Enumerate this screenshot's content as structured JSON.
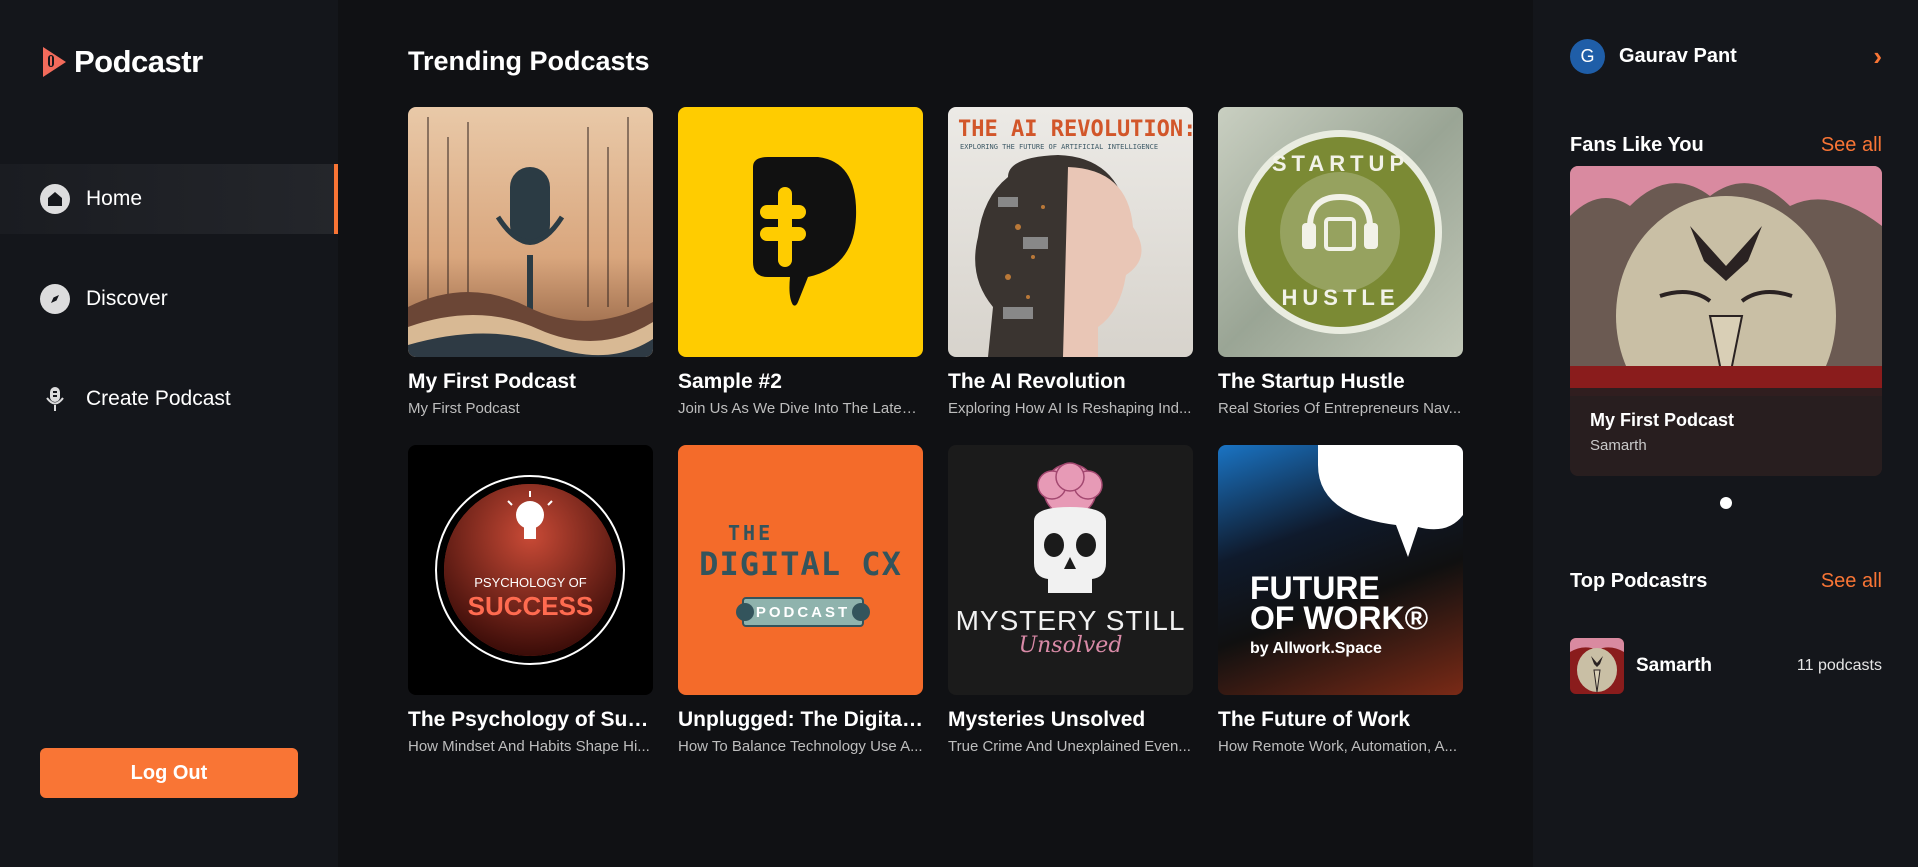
{
  "app": {
    "name": "Podcastr",
    "accent": "#f97535"
  },
  "nav": {
    "items": [
      {
        "label": "Home",
        "icon": "home-icon"
      },
      {
        "label": "Discover",
        "icon": "compass-icon"
      },
      {
        "label": "Create Podcast",
        "icon": "microphone-icon"
      }
    ],
    "logout_label": "Log Out"
  },
  "main": {
    "title": "Trending Podcasts",
    "podcasts": [
      {
        "title": "My First Podcast",
        "description": "My First Podcast"
      },
      {
        "title": "Sample #2",
        "description": "Join Us As We Dive Into The Latest..."
      },
      {
        "title": "The AI Revolution",
        "description": "Exploring How AI Is Reshaping Ind...",
        "cover_text": "THE AI REVOLUTION:",
        "cover_subtext": "EXPLORING THE FUTURE OF ARTIFICIAL INTELLIGENCE"
      },
      {
        "title": "The Startup Hustle",
        "description": "Real Stories Of Entrepreneurs Nav...",
        "cover_text": "STARTUP",
        "cover_subtext": "HUSTLE"
      },
      {
        "title": "The Psychology of Succ...",
        "description": "How Mindset And Habits Shape Hi...",
        "cover_text": "PSYCHOLOGY OF",
        "cover_subtext": "SUCCESS"
      },
      {
        "title": "Unplugged: The Digital ...",
        "description": "How To Balance Technology Use A...",
        "cover_text": "THE",
        "cover_subtext": "DIGITAL CX",
        "cover_badge": "PODCAST"
      },
      {
        "title": "Mysteries Unsolved",
        "description": "True Crime And Unexplained Even...",
        "cover_text": "MYSTERY STILL",
        "cover_subtext": "Unsolved"
      },
      {
        "title": "The Future of Work",
        "description": "How Remote Work, Automation, A...",
        "cover_text": "FUTURE OF WORK®",
        "cover_subtext": "by Allwork.Space"
      }
    ]
  },
  "user": {
    "initial": "G",
    "name": "Gaurav Pant"
  },
  "fans": {
    "title": "Fans Like You",
    "see_all": "See all",
    "featured": {
      "title": "My First Podcast",
      "author": "Samarth"
    }
  },
  "top": {
    "title": "Top Podcastrs",
    "see_all": "See all",
    "items": [
      {
        "name": "Samarth",
        "count": "11 podcasts"
      }
    ]
  }
}
